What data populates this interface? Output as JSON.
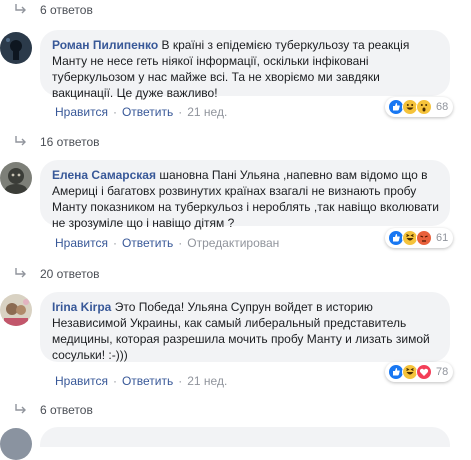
{
  "replies_top": {
    "label": "6 ответов"
  },
  "comments": [
    {
      "author": "Роман Пилипенко",
      "text": "В країні з епідемією туберкульозу та реакція Манту не несе геть ніякої інформації, оскільки інфіковані туберкульозом у нас майже всі. Та не хворіємо ми завдяки вакцинації. Це дуже важливо!",
      "reactions": [
        "like-reaction-icon",
        "love-reaction-icon",
        "wow-reaction-icon"
      ],
      "reaction_count": "68",
      "replies": "16 ответов",
      "like_label": "Нравится",
      "reply_label": "Ответить",
      "time": "21 нед."
    },
    {
      "author": "Елена Самарская",
      "text": "шановна Пані Ульяна ,напевно вам відомо що в Америці і багатовх розвинутих країнах взагалі не визнають пробу Манту показником на туберкульоз і нероблять ,так навіщо вколювати не зрозуміле що і навіщо дітям ?",
      "reactions": [
        "like-reaction-icon",
        "haha-reaction-icon",
        "angry-reaction-icon"
      ],
      "reaction_count": "61",
      "replies": "20 ответов",
      "like_label": "Нравится",
      "reply_label": "Ответить",
      "time": "Отредактирован"
    },
    {
      "author": "Irina Kirpa",
      "text": "Это Победа! Ульяна Супрун войдет в историю Независимой Украины, как самый либеральный представитель медицины, которая разрешила мочить пробу Манту и лизать зимой сосульки! :-)))",
      "reactions": [
        "like-reaction-icon",
        "haha-reaction-icon",
        "love-reaction-icon"
      ],
      "reaction_count": "78",
      "replies": "6 ответов",
      "like_label": "Нравится",
      "reply_label": "Ответить",
      "time": "21 нед."
    }
  ],
  "colors": {
    "link": "#385898",
    "bubble": "#f2f3f5",
    "meta": "#90949c"
  }
}
